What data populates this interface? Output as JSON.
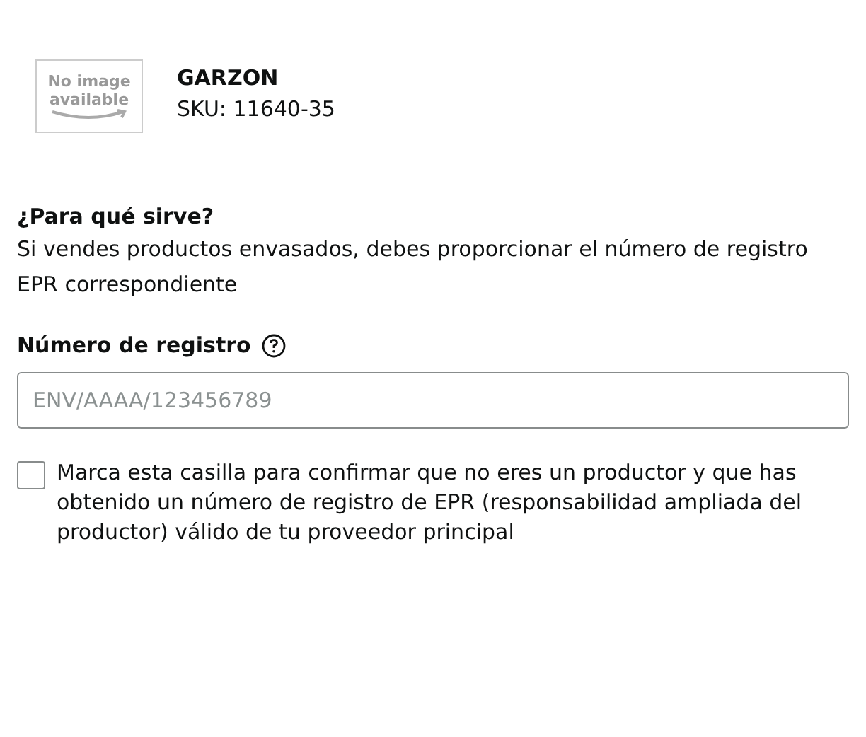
{
  "product": {
    "image_placeholder": "No image available",
    "name": "GARZON",
    "sku": "SKU: 11640-35"
  },
  "help": {
    "title": "¿Para qué sirve?",
    "text": "Si vendes productos envasados, debes proporcionar el número de registro EPR correspondiente"
  },
  "field": {
    "label": "Número de registro",
    "placeholder": "ENV/AAAA/123456789"
  },
  "confirm": {
    "checked": false,
    "text": "Marca esta casilla para confirmar que no eres un productor y que has obtenido un número de registro de EPR (responsabilidad ampliada del productor) válido de tu proveedor principal"
  }
}
